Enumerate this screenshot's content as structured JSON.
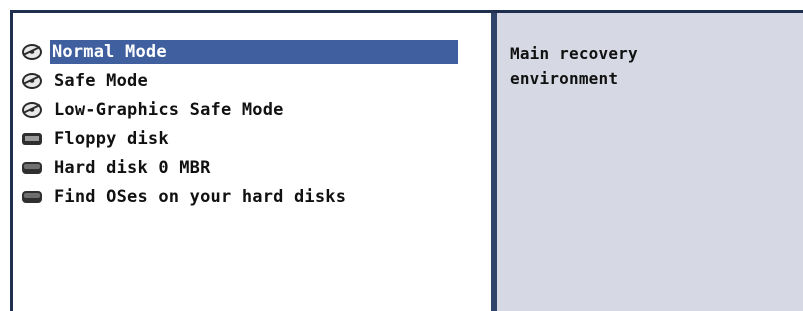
{
  "menu": {
    "items": [
      {
        "label": "Normal Mode",
        "icon": "cd-icon",
        "selected": true
      },
      {
        "label": "Safe Mode",
        "icon": "cd-icon",
        "selected": false
      },
      {
        "label": "Low-Graphics Safe Mode",
        "icon": "cd-icon",
        "selected": false
      },
      {
        "label": "Floppy disk",
        "icon": "floppy-disk-icon",
        "selected": false
      },
      {
        "label": "Hard disk 0 MBR",
        "icon": "hard-disk-icon",
        "selected": false
      },
      {
        "label": "Find OSes on your hard disks",
        "icon": "hard-disk-icon",
        "selected": false
      }
    ]
  },
  "description": {
    "line1": "Main recovery",
    "line2": "environment"
  },
  "colors": {
    "selection": "#3f5f9f",
    "description_bg": "#d6d9e4",
    "divider": "#2f4468"
  }
}
